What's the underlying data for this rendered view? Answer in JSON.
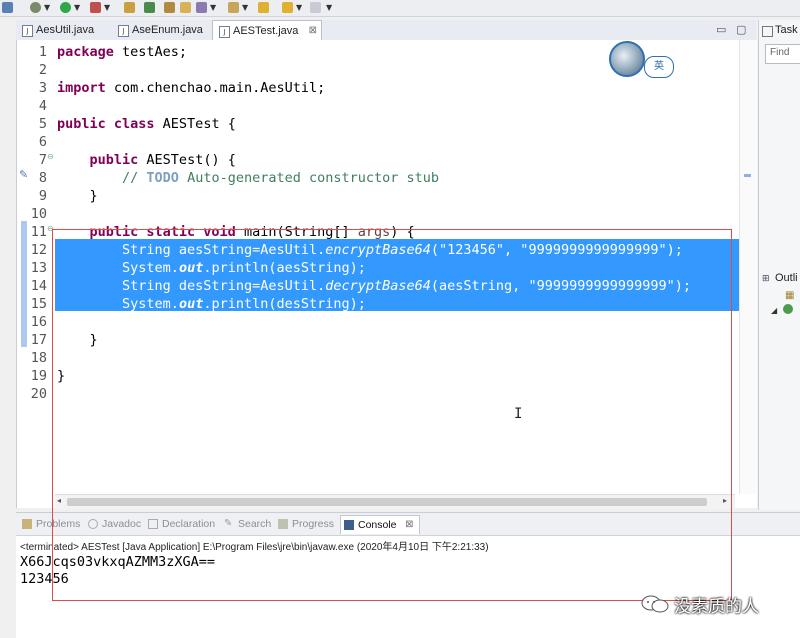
{
  "tabs": [
    {
      "label": "AesUtil.java",
      "active": false
    },
    {
      "label": "AseEnum.java",
      "active": false
    },
    {
      "label": "AESTest.java",
      "active": true
    }
  ],
  "tab_close_glyph": "⊠",
  "right_panel": {
    "task_label": "Task",
    "find_placeholder": "Find",
    "outline_label": "Outli"
  },
  "ime_badge": "英",
  "line_numbers": [
    "1",
    "2",
    "3",
    "4",
    "5",
    "6",
    "7",
    "8",
    "9",
    "10",
    "11",
    "12",
    "13",
    "14",
    "15",
    "16",
    "17",
    "18",
    "19",
    "20"
  ],
  "code": {
    "l1_kw": "package",
    "l1_rest": " testAes;",
    "l3_kw": "import",
    "l3_rest": " com.chenchao.main.AesUtil;",
    "l5_kw": "public class",
    "l5_rest": " AESTest {",
    "l7_kw": "public",
    "l7_rest": " AESTest() {",
    "l8_comment": "// ",
    "l8_todo": "TODO",
    "l8_rest": " Auto-generated constructor stub",
    "l9": "}",
    "l11_kw": "public static void",
    "l11_rest": " main(String[] ",
    "l11_args": "args",
    "l11_end": ") {",
    "l12_a": "String aesString=AesUtil.",
    "l12_m": "encryptBase64",
    "l12_b": "(\"123456\", \"9999999999999999\");",
    "l13_a": "System.",
    "l13_f": "out",
    "l13_b": ".println(aesString);",
    "l14_a": "String desString=AesUtil.",
    "l14_m": "decryptBase64",
    "l14_b": "(aesString, \"9999999999999999\");",
    "l15_a": "System.",
    "l15_f": "out",
    "l15_b": ".println(desString);",
    "l17": "}",
    "l19": "}"
  },
  "console": {
    "tabs": [
      "Problems",
      "Javadoc",
      "Declaration",
      "Search",
      "Progress",
      "Console"
    ],
    "active_tab": "Console",
    "info": "<terminated> AESTest [Java Application] E:\\Program Files\\jre\\bin\\javaw.exe (2020年4月10日 下午2:21:33)",
    "output": [
      "X66Jcqs03vkxqAZMM3zXGA==",
      "123456"
    ]
  },
  "watermark": "没素质的人",
  "colors": {
    "selection": "#3399ff",
    "keyword": "#7f0055",
    "comment": "#3f7f5f",
    "string": "#2a00ff",
    "annotation_box": "#e04a4a"
  }
}
